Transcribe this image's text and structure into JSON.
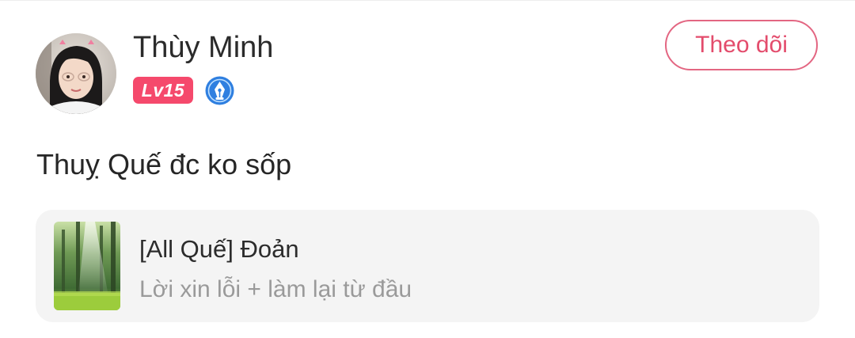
{
  "user": {
    "name": "Thùy Minh",
    "level": "Lv15",
    "avatar_icon": "avatar-photo",
    "author_badge_icon": "pen-nib-icon"
  },
  "follow_button": {
    "label": "Theo dõi"
  },
  "post": {
    "text": "Thuỵ Quế đc ko sốp"
  },
  "story_card": {
    "cover_icon": "forest-cover-image",
    "title": "[All Quế] Đoản",
    "subtitle": "Lời xin lỗi + làm lại từ đầu"
  },
  "colors": {
    "accent": "#e34c6c",
    "level_badge": "#f5496c",
    "author_badge": "#2f7fe0",
    "card_bg": "#f4f4f4",
    "subtitle_text": "#9a9a9a"
  }
}
